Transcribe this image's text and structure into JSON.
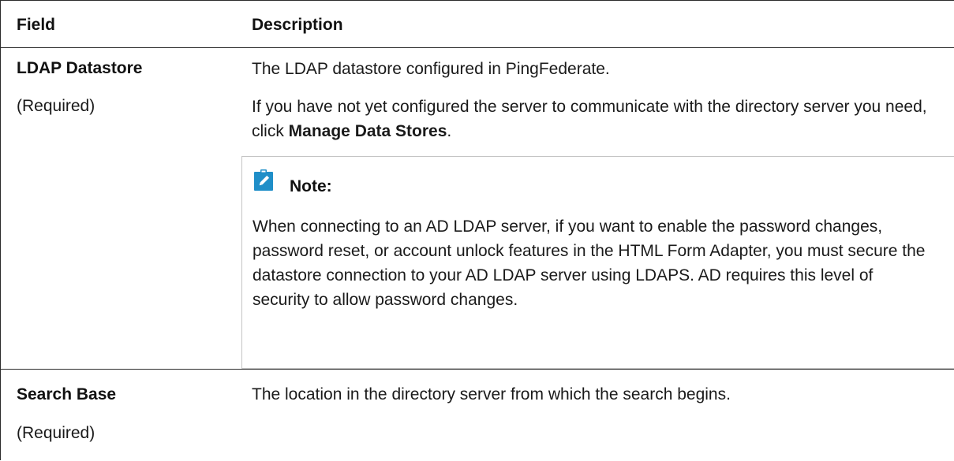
{
  "header": {
    "field": "Field",
    "description": "Description"
  },
  "rows": [
    {
      "name": "LDAP Datastore",
      "required": "(Required)",
      "description": "The LDAP datastore configured in PingFederate.",
      "description2_prefix": "If you have not yet configured the server to communicate with the directory server you need, click ",
      "description2_link": "Manage Data Stores",
      "description2_suffix": ".",
      "note": {
        "icon": "pencil-note-icon",
        "title": "Note:",
        "body": "When connecting to an AD LDAP server, if you want to enable the password changes, password reset, or account unlock features in the HTML Form Adapter, you must secure the datastore connection to your AD LDAP server using LDAPS. AD requires this level of security to allow password changes."
      }
    },
    {
      "name": "Search Base",
      "required": "(Required)",
      "description": "The location in the directory server from which the search begins."
    }
  ],
  "colors": {
    "note_icon_bg": "#1f8ec8",
    "border": "#2b2b2b",
    "note_border": "#c4c4c4"
  }
}
